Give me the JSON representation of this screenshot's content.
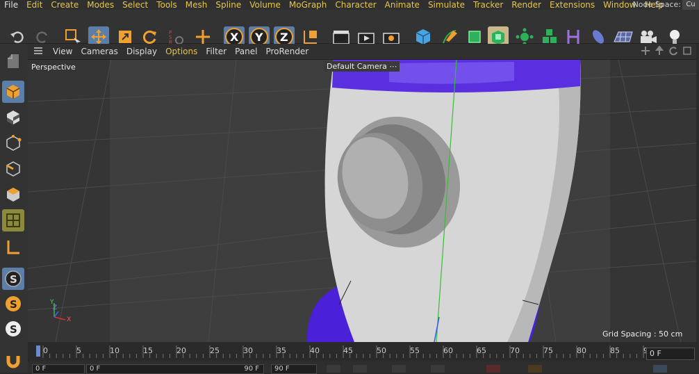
{
  "menubar": {
    "items": [
      "File",
      "Edit",
      "Create",
      "Modes",
      "Select",
      "Tools",
      "Mesh",
      "Spline",
      "Volume",
      "MoGraph",
      "Character",
      "Animate",
      "Simulate",
      "Tracker",
      "Render",
      "Extensions",
      "Window",
      "Help"
    ],
    "node_space_label": "Node Space:",
    "node_space_value": "Cu"
  },
  "viewport_menu": {
    "items": [
      "View",
      "Cameras",
      "Display",
      "Options",
      "Filter",
      "Panel",
      "ProRender"
    ]
  },
  "viewport": {
    "view_name": "Perspective",
    "camera": "Default Camera",
    "grid_spacing": "Grid Spacing : 50 cm",
    "axis_z": "Z",
    "axis_y": "Y",
    "axis_x": "X"
  },
  "timeline": {
    "ticks": [
      "0",
      "5",
      "10",
      "15",
      "20",
      "25",
      "30",
      "35",
      "40",
      "45",
      "50",
      "55",
      "60",
      "65",
      "70",
      "75",
      "80",
      "85",
      "90"
    ],
    "current_frame": "0 F"
  },
  "bottom": {
    "field1": "0 F",
    "field2": "0 F",
    "field3": "90 F",
    "field4": "90 F"
  },
  "colors": {
    "accent_menu": "#e6c64a",
    "selected_tool": "#5b7fa8",
    "rocket_band": "#5a2fe0"
  }
}
